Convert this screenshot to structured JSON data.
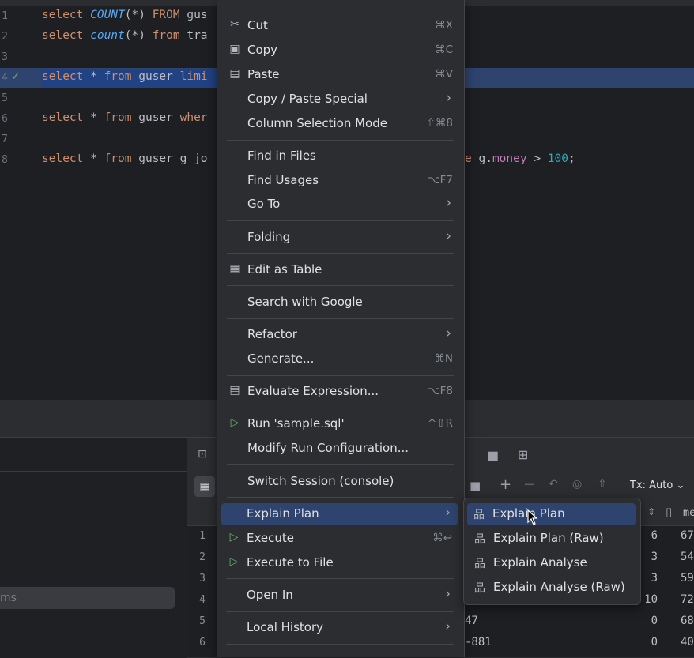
{
  "editor": {
    "line_numbers": [
      "1",
      "2",
      "3",
      "4",
      "5",
      "6",
      "7",
      "8"
    ],
    "lines": {
      "l1": {
        "kw1": "select ",
        "fn": "COUNT",
        "rest": "(*) ",
        "kw2": "FROM",
        "tail": " gus"
      },
      "l2": {
        "kw1": "select ",
        "fn": "count",
        "rest": "(*) ",
        "kw2": "from",
        "tail": " tra"
      },
      "l4": {
        "kw1": "select ",
        "star": "* ",
        "kw2": "from",
        "mid": " guser ",
        "kw3": "limi"
      },
      "l6": {
        "kw1": "select ",
        "star": "* ",
        "kw2": "from",
        "mid": " guser ",
        "kw3": "wher"
      },
      "l8": {
        "kw1": "select ",
        "star": "* ",
        "kw2": "from",
        "mid": " guser g jo"
      },
      "l8_right": {
        "kw": "e",
        "pre": " g.",
        "field": "money",
        "op": " > ",
        "num": "100",
        "end": ";"
      }
    }
  },
  "context_menu": {
    "items": [
      {
        "label": "Cut",
        "shortcut": "⌘X",
        "icon": "scissors-icon"
      },
      {
        "label": "Copy",
        "shortcut": "⌘C",
        "icon": "copy-icon"
      },
      {
        "label": "Paste",
        "shortcut": "⌘V",
        "icon": "paste-icon"
      },
      {
        "label": "Copy / Paste Special"
      },
      {
        "label": "Column Selection Mode",
        "shortcut": "⇧⌘8"
      },
      {
        "label": "Find in Files"
      },
      {
        "label": "Find Usages",
        "shortcut": "⌥F7"
      },
      {
        "label": "Go To"
      },
      {
        "label": "Folding"
      },
      {
        "label": "Edit as Table",
        "icon": "table-icon"
      },
      {
        "label": "Search with Google"
      },
      {
        "label": "Refactor"
      },
      {
        "label": "Generate...",
        "shortcut": "⌘N"
      },
      {
        "label": "Evaluate Expression...",
        "shortcut": "⌥F8",
        "icon": "calculator-icon"
      },
      {
        "label": "Run 'sample.sql'",
        "shortcut": "^⇧R",
        "icon": "run-icon"
      },
      {
        "label": "Modify Run Configuration..."
      },
      {
        "label": "Switch Session (console)"
      },
      {
        "label": "Explain Plan"
      },
      {
        "label": "Execute",
        "shortcut": "⌘↩",
        "icon": "run-icon"
      },
      {
        "label": "Execute to File",
        "icon": "run-icon"
      },
      {
        "label": "Open In"
      },
      {
        "label": "Local History"
      }
    ]
  },
  "submenu": {
    "items": [
      {
        "label": "Explain Plan",
        "icon": "hierarchy-icon"
      },
      {
        "label": "Explain Plan (Raw)",
        "icon": "hierarchy-icon"
      },
      {
        "label": "Explain Analyse",
        "icon": "hierarchy-icon"
      },
      {
        "label": "Explain Analyse (Raw)",
        "icon": "hierarchy-icon"
      }
    ]
  },
  "results": {
    "tx_label": "Tx: Auto",
    "header_partial": "me",
    "row_numbers": [
      "1",
      "2",
      "3",
      "4",
      "5",
      "6"
    ],
    "col_a": [
      "6",
      "3",
      "3",
      "10",
      "0",
      "0"
    ],
    "col_b": [
      "67",
      "54",
      "59",
      "72",
      "68",
      "40"
    ],
    "col_left_partial": [
      "",
      "",
      "",
      "",
      "47",
      "-881"
    ]
  },
  "left_panel": {
    "search_placeholder_partial": "ms"
  }
}
